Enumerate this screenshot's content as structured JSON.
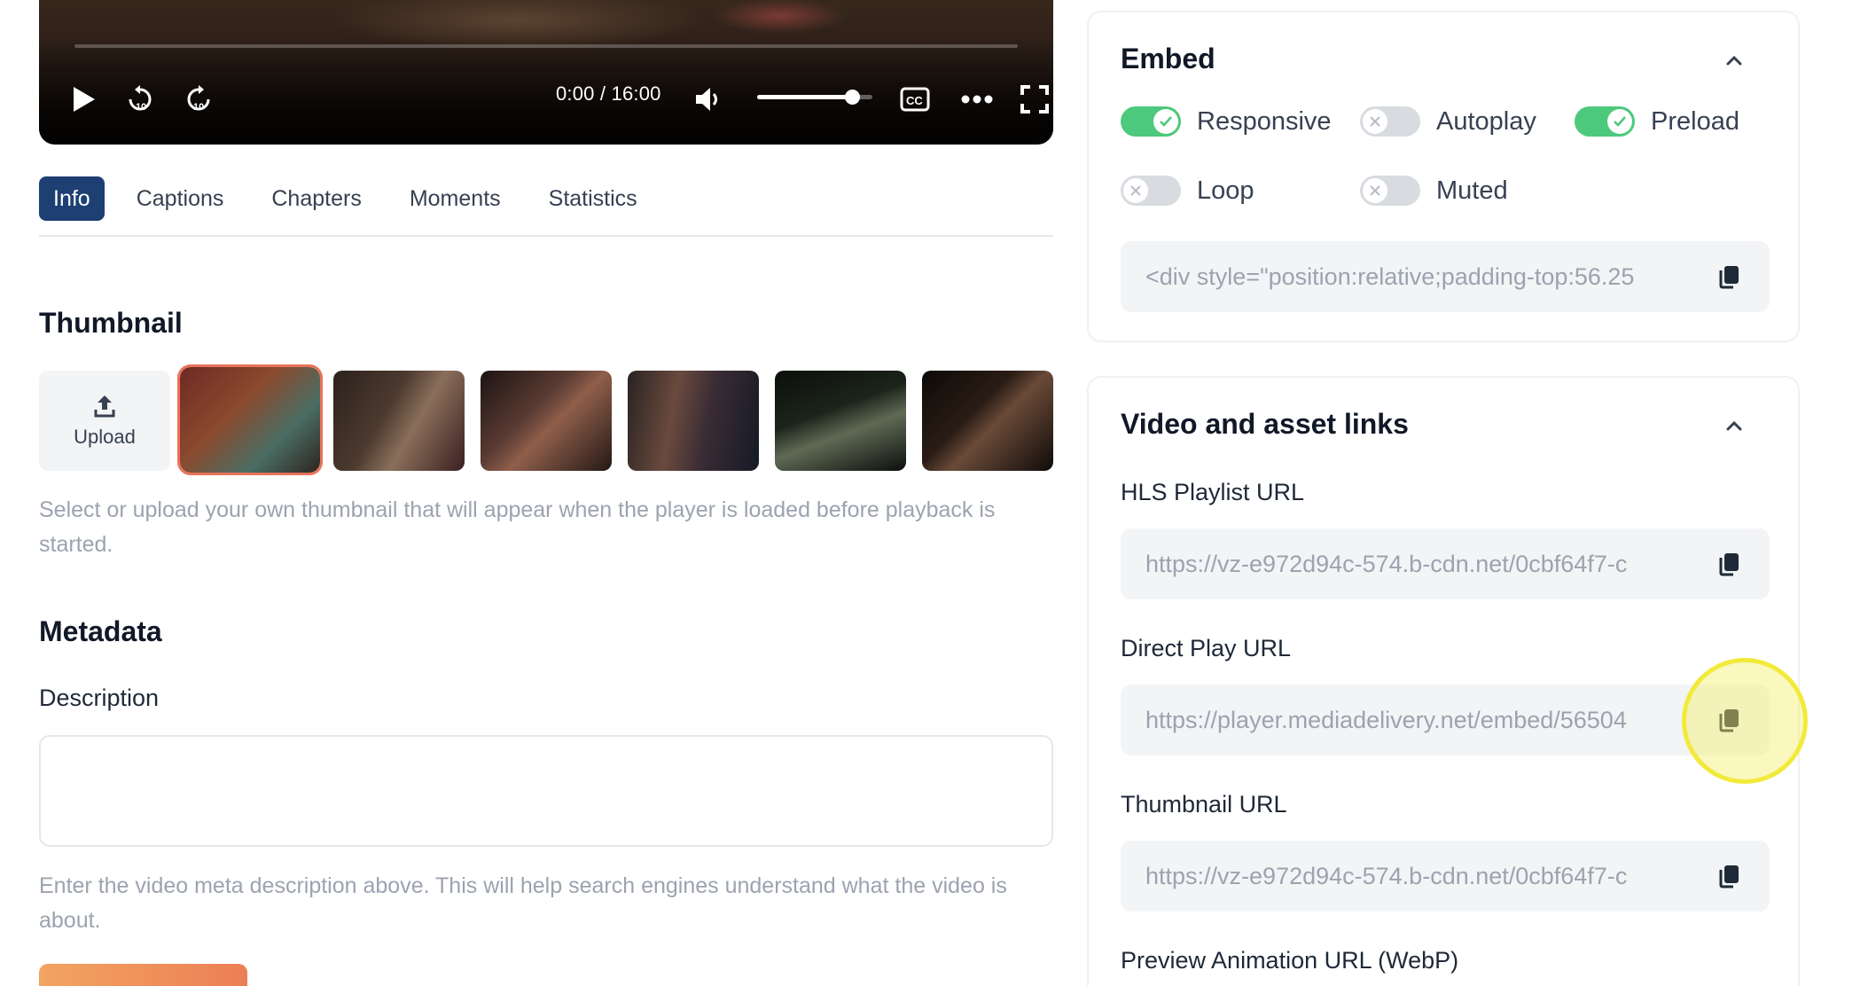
{
  "player": {
    "time": "0:00 / 16:00",
    "volume_fraction": 0.82,
    "icons": [
      "play-icon",
      "rewind-10-icon",
      "forward-10-icon",
      "volume-icon",
      "captions-icon",
      "more-icon",
      "fullscreen-icon"
    ]
  },
  "tabs": [
    {
      "label": "Info",
      "active": true
    },
    {
      "label": "Captions",
      "active": false
    },
    {
      "label": "Chapters",
      "active": false
    },
    {
      "label": "Moments",
      "active": false
    },
    {
      "label": "Statistics",
      "active": false
    }
  ],
  "thumbnail": {
    "heading": "Thumbnail",
    "upload_label": "Upload",
    "help": "Select or upload your own thumbnail that will appear when the player is loaded before playback is started.",
    "selected_index": 0,
    "count": 6
  },
  "metadata": {
    "heading": "Metadata",
    "description_label": "Description",
    "description_value": "",
    "help": "Enter the video meta description above. This will help search engines understand what the video is about."
  },
  "embed": {
    "title": "Embed",
    "toggles": [
      {
        "label": "Responsive",
        "on": true
      },
      {
        "label": "Autoplay",
        "on": false
      },
      {
        "label": "Preload",
        "on": true
      },
      {
        "label": "Loop",
        "on": false
      },
      {
        "label": "Muted",
        "on": false
      }
    ],
    "code": "<div style=\"position:relative;padding-top:56.25"
  },
  "links": {
    "title": "Video and asset links",
    "hls_label": "HLS Playlist URL",
    "hls_value": "https://vz-e972d94c-574.b-cdn.net/0cbf64f7-c",
    "direct_label": "Direct Play URL",
    "direct_value": "https://player.mediadelivery.net/embed/56504",
    "thumb_label": "Thumbnail URL",
    "thumb_value": "https://vz-e972d94c-574.b-cdn.net/0cbf64f7-c",
    "preview_label": "Preview Animation URL (WebP)"
  },
  "colors": {
    "tab_active": "#1d3f72",
    "toggle_on": "#4cc97c",
    "toggle_off": "#d8dbe0",
    "selected_thumb_border": "#e8735a",
    "highlight": "#f2ea3a"
  }
}
